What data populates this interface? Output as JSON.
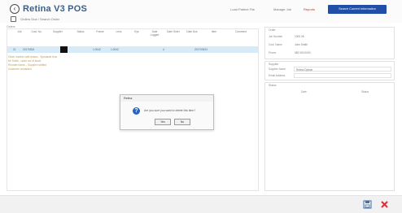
{
  "app": {
    "title": "Retina V3 POS",
    "primary_action": "Search Current Information"
  },
  "toplinks": [
    {
      "label": "Load Patient File"
    },
    {
      "label": "Manage Job"
    },
    {
      "label": "Reports"
    }
  ],
  "breadcrumb": "Orders Due / Search Order",
  "mini_label": "Orders",
  "grid": {
    "headers": [
      "Job",
      "Cust. No.",
      "Supplier",
      "Status",
      "Frame",
      "Lens",
      "Eye",
      "Date Logged",
      "Date Order",
      "Date Due",
      "Item",
      "Comment"
    ],
    "row": {
      "job": "21",
      "cust": "20170524",
      "col5": "1.0042",
      "col6": "1.0042",
      "col10": "4",
      "col11": "2017/05/24"
    },
    "notes": [
      "Order number with lenses - Spectacle lens",
      "Mr Smith - order out of stock",
      "Reorder frame – Supplier notified",
      "Customer contacted"
    ]
  },
  "right_panel": {
    "order_section": "Order",
    "order_fields": [
      {
        "label": "Job Number",
        "value": "1000 26"
      },
      {
        "label": "Cust. Name",
        "value": "John Smith"
      },
      {
        "label": "Phone",
        "value": "082 000 0000"
      }
    ],
    "supplier_section": "Supplier",
    "supplier_fields": [
      {
        "label": "Supplier Name",
        "value": "Retina Optical"
      },
      {
        "label": "Email Address",
        "value": ""
      }
    ],
    "status_section": "Status",
    "status_table_headers": [
      "Date",
      "Status"
    ]
  },
  "dialog": {
    "title": "Retina",
    "message": "Are you sure you want to delete this item?",
    "yes_label": "Yes",
    "no_label": "No"
  },
  "footer": {
    "save_icon": "save-icon",
    "close_icon": "close-icon"
  },
  "colors": {
    "accent": "#1f4fa6",
    "selected_row": "#d6ebf7",
    "close": "#d9303a"
  }
}
